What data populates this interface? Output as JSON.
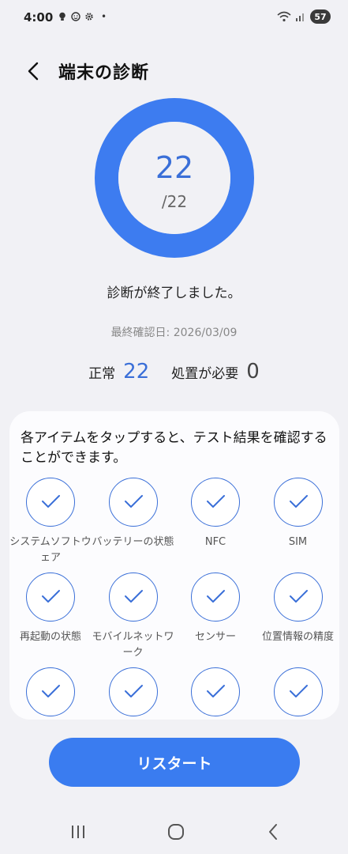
{
  "status_bar": {
    "time": "4:00",
    "dot": "•",
    "battery": "57",
    "icons": [
      "bulb-icon",
      "face-icon",
      "gear-icon",
      "wifi-icon",
      "signal-icon"
    ]
  },
  "header": {
    "title": "端末の診断",
    "back_icon": "chevron-left-icon"
  },
  "result": {
    "score": "22",
    "total": "/22",
    "progress_fraction": 1.0,
    "done_message": "診断が終了しました。",
    "last_check": "最終確認日: 2026/03/09",
    "normal_label": "正常",
    "normal_count": "22",
    "action_label": "処置が必要",
    "action_count": "0"
  },
  "card": {
    "instruction": "各アイテムをタップすると、テスト結果を確認することができます。",
    "items": [
      {
        "label": "システムソフトウェア"
      },
      {
        "label": "バッテリーの状態"
      },
      {
        "label": "NFC"
      },
      {
        "label": "SIM"
      },
      {
        "label": "再起動の状態"
      },
      {
        "label": "モバイルネットワーク"
      },
      {
        "label": "センサー"
      },
      {
        "label": "位置情報の精度"
      },
      {
        "label": ""
      },
      {
        "label": ""
      },
      {
        "label": ""
      },
      {
        "label": ""
      }
    ]
  },
  "restart_label": "リスタート",
  "colors": {
    "accent": "#3a7cf0",
    "ring": "#3d7cf0",
    "background": "#f1f1f5"
  }
}
